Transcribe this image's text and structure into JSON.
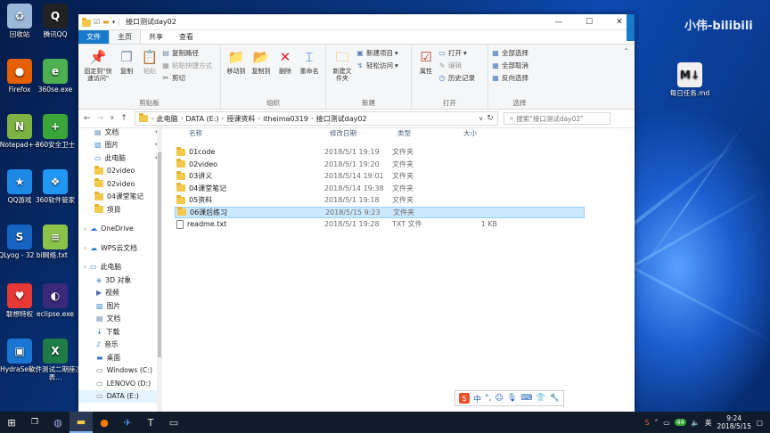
{
  "desktop": {
    "icons": [
      {
        "id": "recycle",
        "label": "回收站",
        "color": "#9bb8d8",
        "glyph": "♻"
      },
      {
        "id": "qq",
        "label": "腾讯QQ",
        "color": "#222",
        "glyph": "Q"
      },
      {
        "id": "firefox",
        "label": "Firefox",
        "color": "#e66000",
        "glyph": "●"
      },
      {
        "id": "se360",
        "label": "360se.exe",
        "color": "#4caf50",
        "glyph": "e"
      },
      {
        "id": "notepadpp",
        "label": "Notepad++",
        "color": "#7cb342",
        "glyph": "N"
      },
      {
        "id": "safe360",
        "label": "360安全卫士",
        "color": "#3aa63a",
        "glyph": "+"
      },
      {
        "id": "qqgame",
        "label": "QQ游戏",
        "color": "#1e88e5",
        "glyph": "★"
      },
      {
        "id": "soft360",
        "label": "360软件管家",
        "color": "#2196f3",
        "glyph": "❖"
      },
      {
        "id": "sqlyog",
        "label": "SQLyog - 32 bit",
        "color": "#1565c0",
        "glyph": "S"
      },
      {
        "id": "wangluo",
        "label": "网络.txt",
        "color": "#8bc34a",
        "glyph": "≡"
      },
      {
        "id": "lenovo",
        "label": "联想特权",
        "color": "#e53935",
        "glyph": "♥"
      },
      {
        "id": "eclipse",
        "label": "eclipse.exe",
        "color": "#3b2a7a",
        "glyph": "◐"
      },
      {
        "id": "hydra",
        "label": "HydraSen...",
        "color": "#1976d2",
        "glyph": "▣"
      },
      {
        "id": "excel",
        "label": "软件测试二期座次表...",
        "color": "#1e7b45",
        "glyph": "X"
      },
      {
        "id": "mdfile",
        "label": "每日任务.md",
        "color": "#f2f2f2",
        "glyph": "M↓"
      }
    ]
  },
  "watermark": "小伟-bilibili",
  "window": {
    "title": "接口测试day02",
    "ribbon_tabs": [
      "文件",
      "主页",
      "共享",
      "查看"
    ],
    "groups": {
      "clipboard": {
        "label": "剪贴板",
        "pin": "固定到\"快速访问\"",
        "copy": "复制",
        "paste": "粘贴",
        "copy_path": "复制路径",
        "paste_shortcut": "粘贴快捷方式",
        "cut": "剪切"
      },
      "organize": {
        "label": "组织",
        "move_to": "移动到",
        "copy_to": "复制到",
        "delete": "删除",
        "rename": "重命名"
      },
      "new": {
        "label": "新建",
        "new_folder": "新建文件夹",
        "new_item": "新建项目",
        "easy_access": "轻松访问"
      },
      "open": {
        "label": "打开",
        "properties": "属性",
        "open": "打开",
        "edit": "编辑",
        "history": "历史记录"
      },
      "select": {
        "label": "选择",
        "select_all": "全部选择",
        "select_none": "全部取消",
        "invert": "反向选择"
      }
    },
    "address": {
      "segments": [
        "此电脑",
        "DATA (E:)",
        "授课资料",
        "itheima0319",
        "接口测试day02"
      ],
      "search_placeholder": "搜索\"接口测试day02\""
    },
    "nav": [
      {
        "label": "文档",
        "level": "l1",
        "icon": "doc",
        "pinned": true
      },
      {
        "label": "图片",
        "level": "l1",
        "icon": "pic",
        "pinned": true
      },
      {
        "label": "此电脑",
        "level": "l1",
        "icon": "pc",
        "pinned": true
      },
      {
        "label": "02video",
        "level": "l1",
        "icon": "folder",
        "pinned": false
      },
      {
        "label": "02video",
        "level": "l1",
        "icon": "folder",
        "pinned": false
      },
      {
        "label": "04课堂笔记",
        "level": "l1",
        "icon": "folder",
        "pinned": false
      },
      {
        "label": "项目",
        "level": "l1",
        "icon": "folder",
        "pinned": false
      },
      {
        "label": "",
        "level": "gap",
        "icon": "",
        "pinned": false
      },
      {
        "label": "OneDrive",
        "level": "top",
        "icon": "cloud",
        "pinned": false
      },
      {
        "label": "",
        "level": "gap",
        "icon": "",
        "pinned": false
      },
      {
        "label": "WPS云文档",
        "level": "top",
        "icon": "cloud",
        "pinned": false
      },
      {
        "label": "",
        "level": "gap",
        "icon": "",
        "pinned": false
      },
      {
        "label": "此电脑",
        "level": "top",
        "icon": "pc",
        "pinned": false
      },
      {
        "label": "3D 对象",
        "level": "l2",
        "icon": "3d",
        "pinned": false
      },
      {
        "label": "视频",
        "level": "l2",
        "icon": "video",
        "pinned": false
      },
      {
        "label": "图片",
        "level": "l2",
        "icon": "pic",
        "pinned": false
      },
      {
        "label": "文档",
        "level": "l2",
        "icon": "doc",
        "pinned": false
      },
      {
        "label": "下载",
        "level": "l2",
        "icon": "down",
        "pinned": false
      },
      {
        "label": "音乐",
        "level": "l2",
        "icon": "music",
        "pinned": false
      },
      {
        "label": "桌面",
        "level": "l2",
        "icon": "desk",
        "pinned": false
      },
      {
        "label": "Windows (C:)",
        "level": "l2",
        "icon": "drive",
        "pinned": false
      },
      {
        "label": "LENOVO (D:)",
        "level": "l2",
        "icon": "drive",
        "pinned": false
      },
      {
        "label": "DATA (E:)",
        "level": "l2",
        "icon": "drive",
        "pinned": false
      }
    ],
    "columns": {
      "name": "名称",
      "date": "修改日期",
      "type": "类型",
      "size": "大小"
    },
    "files": [
      {
        "name": "01code",
        "date": "2018/5/1 19:19",
        "type": "文件夹",
        "size": "",
        "kind": "folder",
        "selected": false
      },
      {
        "name": "02video",
        "date": "2018/5/1 19:20",
        "type": "文件夹",
        "size": "",
        "kind": "folder",
        "selected": false
      },
      {
        "name": "03讲义",
        "date": "2018/5/14 19:01",
        "type": "文件夹",
        "size": "",
        "kind": "folder",
        "selected": false
      },
      {
        "name": "04课堂笔记",
        "date": "2018/5/14 19:38",
        "type": "文件夹",
        "size": "",
        "kind": "folder",
        "selected": false
      },
      {
        "name": "05资料",
        "date": "2018/5/1 19:18",
        "type": "文件夹",
        "size": "",
        "kind": "folder",
        "selected": false
      },
      {
        "name": "06课后练习",
        "date": "2018/5/15 9:23",
        "type": "文件夹",
        "size": "",
        "kind": "folder",
        "selected": true
      },
      {
        "name": "readme.txt",
        "date": "2018/5/1 19:28",
        "type": "TXT 文件",
        "size": "1 KB",
        "kind": "txt",
        "selected": false
      }
    ]
  },
  "ime": {
    "logo": "S",
    "mode": "中"
  },
  "taskbar": {
    "time": "9:24",
    "date": "2018/5/15",
    "tray_badge": "44"
  }
}
